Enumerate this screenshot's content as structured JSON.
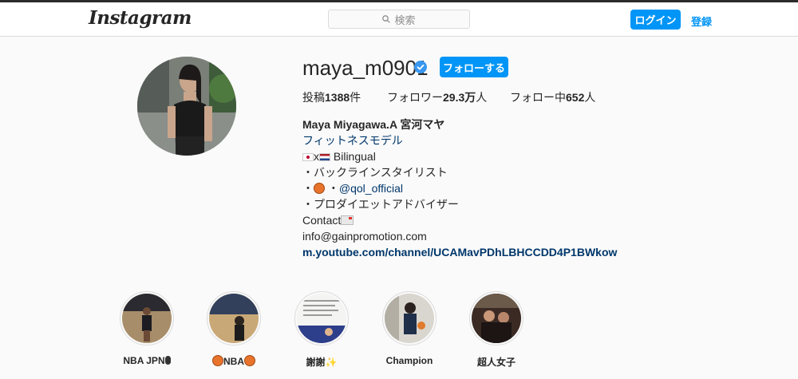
{
  "nav": {
    "logo": "Instagram",
    "search_placeholder": "検索",
    "login_label": "ログイン",
    "signup_label": "登録"
  },
  "profile": {
    "username": "maya_m0901",
    "follow_label": "フォローする",
    "stats": {
      "posts_label": "投稿",
      "posts_value": "1388",
      "posts_unit": "件",
      "followers_label": "フォロワー",
      "followers_value": "29.3万",
      "followers_unit": "人",
      "following_label": "フォロー中",
      "following_value": "652",
      "following_unit": "人"
    },
    "bio": {
      "full_name": "Maya Miyagawa.A 宮河マヤ",
      "category": "フィットネスモデル",
      "line1_text": "x",
      "line1_tail": " Bilingual",
      "line2": "・バックラインスタイリスト",
      "line3_prefix": "・",
      "line3_mid": " ・",
      "line3_mention": "@qol_official",
      "line4": "・プロダイエットアドバイザー",
      "contact": "Contact",
      "email": "info@gainpromotion.com",
      "link": "m.youtube.com/channel/UCAMavPDhLBHCCDD4P1BWkow"
    }
  },
  "highlights": [
    {
      "label": "NBA JPN"
    },
    {
      "label": "NBA"
    },
    {
      "label": "謝謝"
    },
    {
      "label": "Champion"
    },
    {
      "label": "超人女子"
    }
  ],
  "colors": {
    "accent": "#0095f6",
    "link": "#00376b",
    "text": "#262626",
    "background": "#fafafa"
  }
}
